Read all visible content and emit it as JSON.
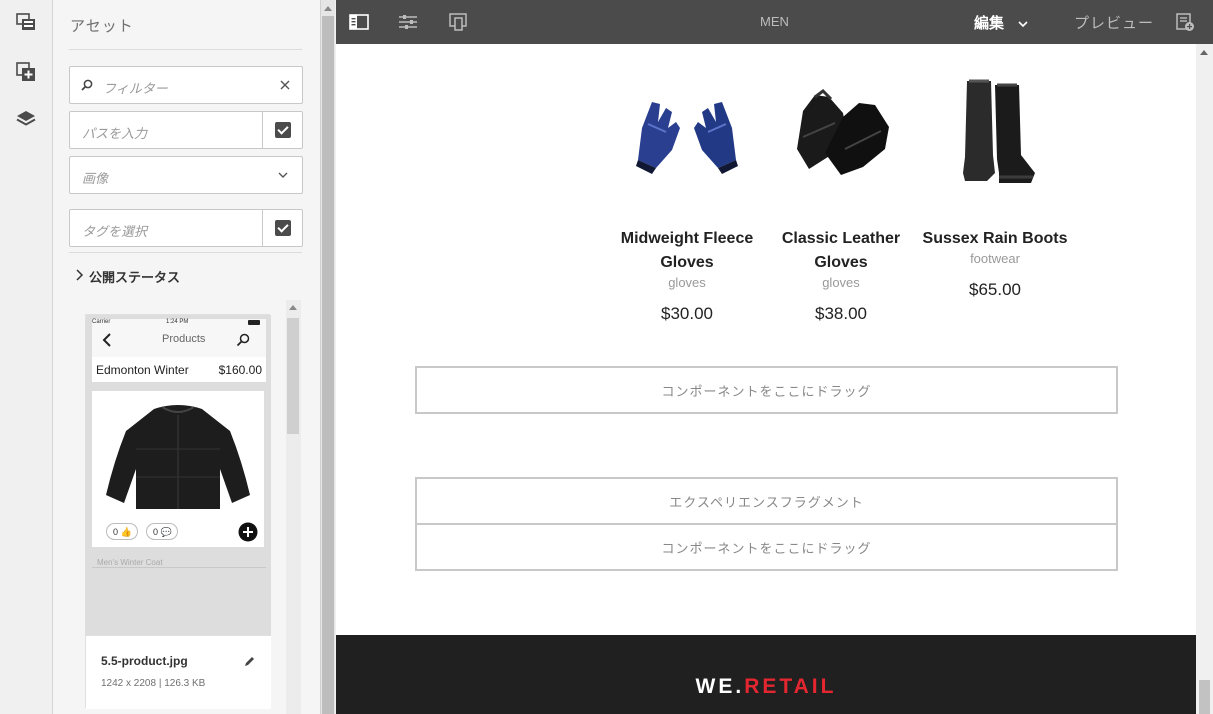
{
  "side_panel": {
    "title": "アセット",
    "filter_placeholder": "フィルター",
    "path_placeholder": "パスを入力",
    "type_value": "画像",
    "tag_placeholder": "タグを選択",
    "publish_status": "公開ステータス"
  },
  "asset_card": {
    "preview_status": {
      "carrier": "Carrier",
      "time": "1:24 PM"
    },
    "preview_header": "Products",
    "preview_product": "Edmonton Winter",
    "preview_price": "$160.00",
    "preview_likes": "0",
    "preview_comments": "0",
    "preview_caption": "Men's Winter Coat",
    "file_name": "5.5-product.jpg",
    "file_meta": "1242 x 2208 | 126.3 KB"
  },
  "toolbar": {
    "page_title": "MEN",
    "mode": "編集",
    "preview": "プレビュー"
  },
  "products": [
    {
      "name": "Midweight Fleece Gloves",
      "category": "gloves",
      "price": "$30.00"
    },
    {
      "name": "Classic Leather Gloves",
      "category": "gloves",
      "price": "$38.00"
    },
    {
      "name": "Sussex Rain Boots",
      "category": "footwear",
      "price": "$65.00"
    }
  ],
  "dropzones": {
    "drag_here_1": "コンポーネントをここにドラッグ",
    "fragment": "エクスペリエンスフラグメント",
    "drag_here_2": "コンポーネントをここにドラッグ"
  },
  "footer": {
    "brand_a": "WE.",
    "brand_b": "RETAIL"
  },
  "colors": {
    "toolbar": "#4b4b4b",
    "accent": "#e3262f",
    "footer": "#202020"
  }
}
